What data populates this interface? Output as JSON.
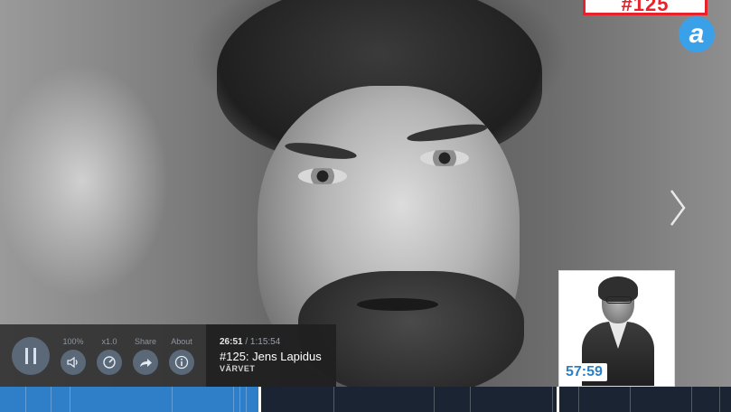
{
  "hero": {
    "description_icon": "portrait-photo"
  },
  "badge": {
    "text": "#125"
  },
  "logo": {
    "letter": "a",
    "color": "#3aa0e8"
  },
  "player": {
    "pause_icon": "pause-icon",
    "controls": [
      {
        "label": "100%",
        "icon": "volume-icon"
      },
      {
        "label": "x1.0",
        "icon": "speed-icon"
      },
      {
        "label": "Share",
        "icon": "share-icon"
      },
      {
        "label": "About",
        "icon": "info-icon"
      }
    ],
    "elapsed": "26:51",
    "separator": " / ",
    "total": "1:15:54",
    "title": "#125: Jens Lapidus",
    "show": "VÄRVET"
  },
  "next_episode": {
    "duration": "57:59"
  },
  "timeline": {
    "progress": 0.354,
    "accent": "#2f7fc8"
  }
}
